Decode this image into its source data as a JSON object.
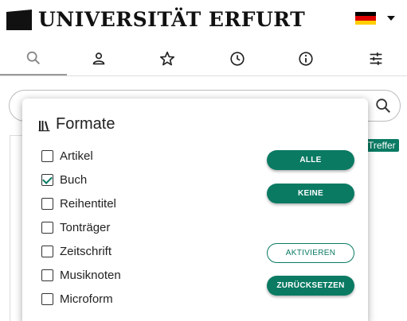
{
  "header": {
    "logo_text": "UNIVERSITÄT ERFURT",
    "language_flag_colors": [
      "#000000",
      "#dd0000",
      "#ffce00"
    ]
  },
  "nav": {
    "tabs": [
      {
        "icon": "search-icon",
        "active": true
      },
      {
        "icon": "person-icon",
        "active": false
      },
      {
        "icon": "star-icon",
        "active": false
      },
      {
        "icon": "clock-icon",
        "active": false
      },
      {
        "icon": "info-icon",
        "active": false
      },
      {
        "icon": "sliders-icon",
        "active": false
      }
    ]
  },
  "search": {
    "placeholder": ""
  },
  "results": {
    "badge": "Treffer"
  },
  "popup": {
    "title": "Formate",
    "options": [
      {
        "label": "Artikel",
        "checked": false
      },
      {
        "label": "Buch",
        "checked": true
      },
      {
        "label": "Reihentitel",
        "checked": false
      },
      {
        "label": "Tonträger",
        "checked": false
      },
      {
        "label": "Zeitschrift",
        "checked": false
      },
      {
        "label": "Musiknoten",
        "checked": false
      },
      {
        "label": "Microform",
        "checked": false
      }
    ],
    "buttons": {
      "all": "ALLE",
      "none": "KEINE",
      "activate": "AKTIVIEREN",
      "reset": "ZURÜCKSETZEN"
    }
  },
  "colors": {
    "accent": "#0a7a63"
  }
}
